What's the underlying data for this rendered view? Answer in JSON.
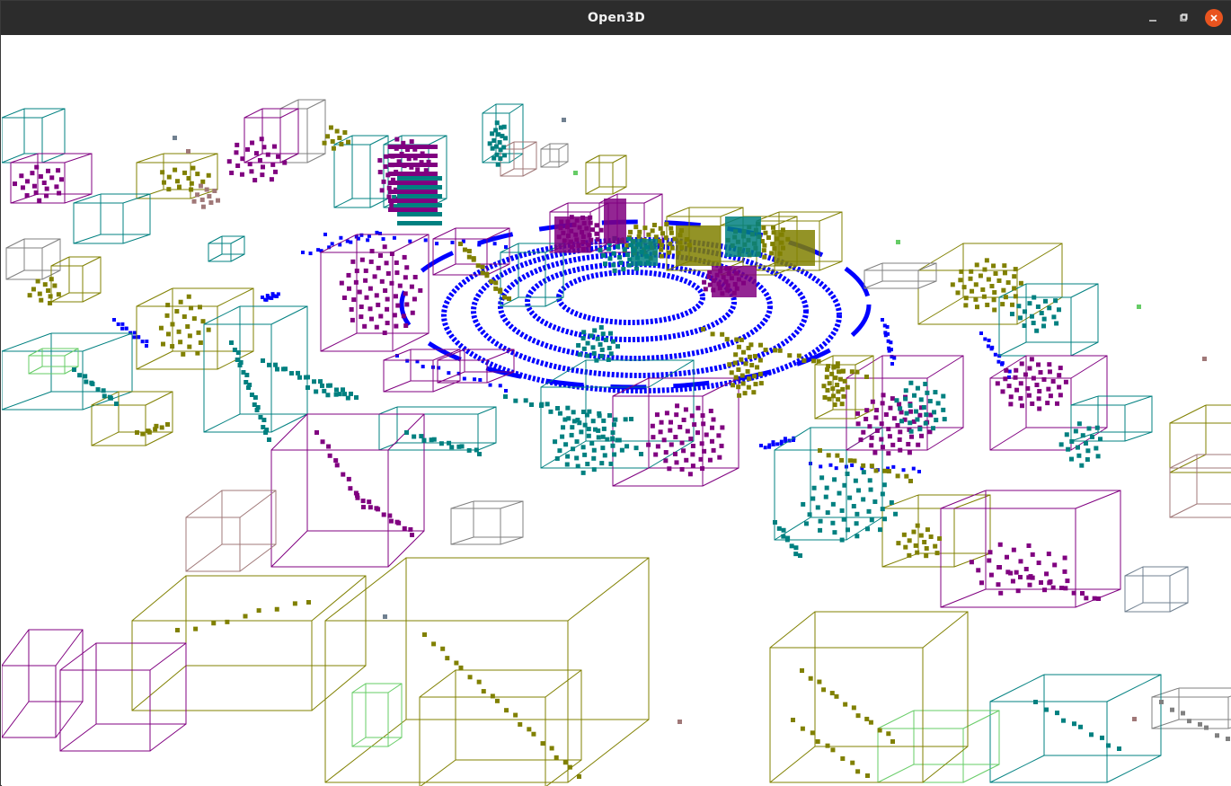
{
  "window": {
    "title": "Open3D",
    "controls": {
      "minimize_icon": "minimize-icon",
      "maximize_icon": "maximize-icon",
      "close_icon": "close-icon"
    }
  },
  "scene": {
    "background": "#ffffff",
    "colors": {
      "lidar_points": "#0000ff",
      "olive": "#808000",
      "purple": "#800080",
      "teal": "#008080",
      "gray": "#808080",
      "rose": "#a07878",
      "green": "#66cc66",
      "slate": "#708090"
    }
  }
}
